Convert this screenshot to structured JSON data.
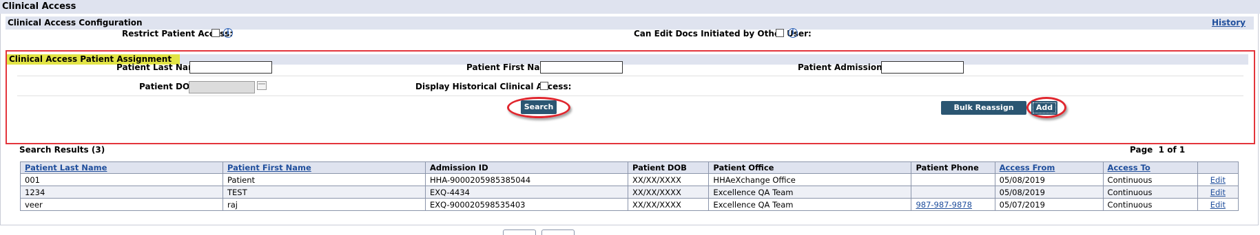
{
  "page": {
    "title": "Clinical Access"
  },
  "config": {
    "title": "Clinical Access Configuration",
    "history_label": "History",
    "restrict_label": "Restrict Patient Access:",
    "can_edit_label": "Can Edit Docs Initiated by Other User:",
    "info_glyph": "i"
  },
  "assignment": {
    "title": "Clinical Access Patient Assignment",
    "last_name_label": "Patient Last Name:",
    "first_name_label": "Patient First Name:",
    "admission_id_label": "Patient Admission ID:",
    "dob_label": "Patient DOB:",
    "historical_label": "Display Historical Clinical Access:",
    "search_label": "Search",
    "bulk_label": "Bulk Reassign Access",
    "add_label": "Add"
  },
  "results": {
    "title": "Search Results (3)",
    "page_label": "Page",
    "page_value": "1 of 1",
    "columns": [
      "Patient Last Name",
      "Patient First Name",
      "Admission ID",
      "Patient DOB",
      "Patient Office",
      "Patient Phone",
      "Access From",
      "Access To",
      ""
    ],
    "rows": [
      {
        "last": "001",
        "first": "Patient",
        "admission": "HHA-9000205985385044",
        "dob": "XX/XX/XXXX",
        "office": "HHAeXchange Office",
        "phone": "",
        "from": "05/08/2019",
        "to": "Continuous",
        "edit": "Edit"
      },
      {
        "last": "1234",
        "first": "TEST",
        "admission": "EXQ-4434",
        "dob": "XX/XX/XXXX",
        "office": "Excellence QA Team",
        "phone": "",
        "from": "05/08/2019",
        "to": "Continuous",
        "edit": "Edit"
      },
      {
        "last": "veer",
        "first": "raj",
        "admission": "EXQ-900020598535403",
        "dob": "XX/XX/XXXX",
        "office": "Excellence QA Team",
        "phone": "987-987-9878",
        "from": "05/07/2019",
        "to": "Continuous",
        "edit": "Edit"
      }
    ]
  },
  "colors": {
    "header_bg": "#dfe3ef",
    "button_bg": "#2b5672",
    "highlight": "#e2e445",
    "annotation_red": "#e0262e",
    "link": "#1f4e9c"
  }
}
